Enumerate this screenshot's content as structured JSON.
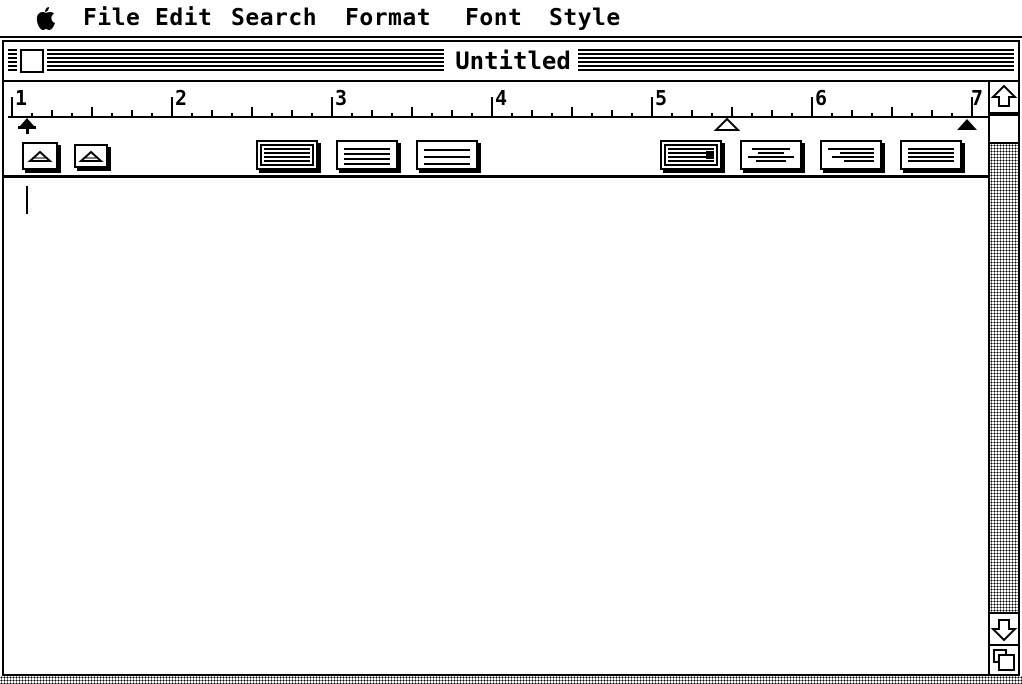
{
  "menubar": {
    "apple_icon": "apple-icon",
    "items": [
      "File",
      "Edit",
      "Search",
      "Format",
      "Font",
      "Style"
    ]
  },
  "window": {
    "title": "Untitled",
    "close_box_icon": "close-box-icon"
  },
  "ruler": {
    "numbers": [
      "1",
      "2",
      "3",
      "4",
      "5",
      "6",
      "7"
    ],
    "spacing_buttons": [
      "single-spacing-icon",
      "double-spacing-icon"
    ],
    "line_spacing_buttons": [
      "line-spacing-single-icon",
      "line-spacing-one-and-half-icon",
      "line-spacing-double-icon"
    ],
    "alignment_buttons": [
      "align-left-icon",
      "align-center-icon",
      "align-right-icon",
      "align-justify-icon"
    ],
    "markers": [
      "left-margin-marker-icon",
      "tab-marker-icon",
      "right-margin-marker-icon"
    ]
  },
  "document": {
    "text": ""
  },
  "scrollbar": {
    "up_icon": "scroll-up-arrow-icon",
    "down_icon": "scroll-down-arrow-icon",
    "grow_icon": "grow-box-icon"
  }
}
